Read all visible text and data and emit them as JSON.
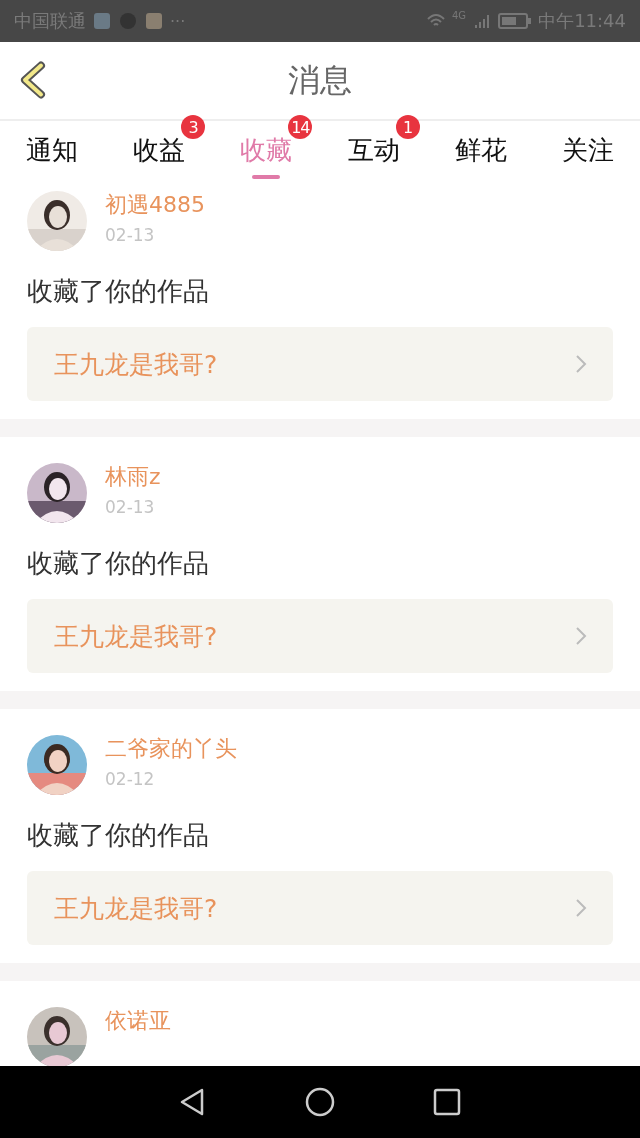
{
  "status_bar": {
    "carrier": "中国联通",
    "more": "···",
    "network": "4G",
    "time": "中午11:44"
  },
  "header": {
    "title": "消息"
  },
  "tabs": [
    {
      "label": "通知",
      "selected": false
    },
    {
      "label": "收益",
      "selected": false,
      "badge": "3"
    },
    {
      "label": "收藏",
      "selected": true,
      "badge": "14"
    },
    {
      "label": "互动",
      "selected": false,
      "badge": "1"
    },
    {
      "label": "鲜花",
      "selected": false
    },
    {
      "label": "关注",
      "selected": false
    }
  ],
  "messages": [
    {
      "user": "初遇4885",
      "date": "02-13",
      "action": "收藏了你的作品",
      "work": "王九龙是我哥?"
    },
    {
      "user": "林雨z",
      "date": "02-13",
      "action": "收藏了你的作品",
      "work": "王九龙是我哥?"
    },
    {
      "user": "二爷家的丫头",
      "date": "02-12",
      "action": "收藏了你的作品",
      "work": "王九龙是我哥?"
    },
    {
      "user": "依诺亚"
    }
  ]
}
